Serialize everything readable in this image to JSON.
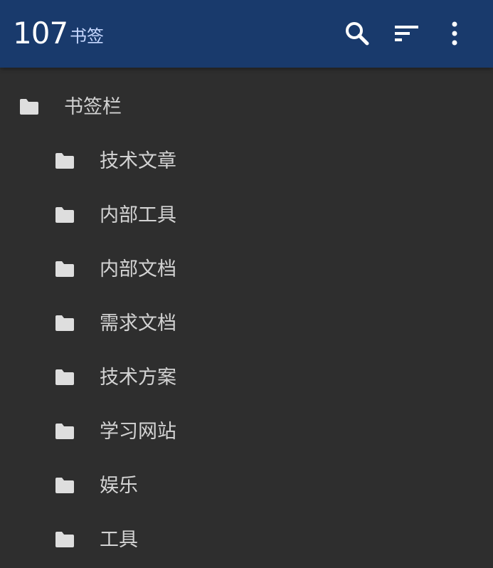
{
  "header": {
    "count": "107",
    "title": "书签",
    "background": "#193a6c",
    "actions": [
      {
        "name": "search-icon"
      },
      {
        "name": "sort-icon"
      },
      {
        "name": "more-vertical-icon"
      }
    ]
  },
  "bookmarks": {
    "root": {
      "label": "书签栏",
      "icon": "folder-icon"
    },
    "children": [
      {
        "label": "技术文章",
        "icon": "folder-icon"
      },
      {
        "label": "内部工具",
        "icon": "folder-icon"
      },
      {
        "label": "内部文档",
        "icon": "folder-icon"
      },
      {
        "label": "需求文档",
        "icon": "folder-icon"
      },
      {
        "label": "技术方案",
        "icon": "folder-icon"
      },
      {
        "label": "学习网站",
        "icon": "folder-icon"
      },
      {
        "label": "娱乐",
        "icon": "folder-icon"
      },
      {
        "label": "工具",
        "icon": "folder-icon"
      }
    ]
  },
  "colors": {
    "background": "#2e2e2e",
    "text": "#d3d3d3",
    "icon": "#dedede",
    "accent_text": "#c7d8ff"
  }
}
